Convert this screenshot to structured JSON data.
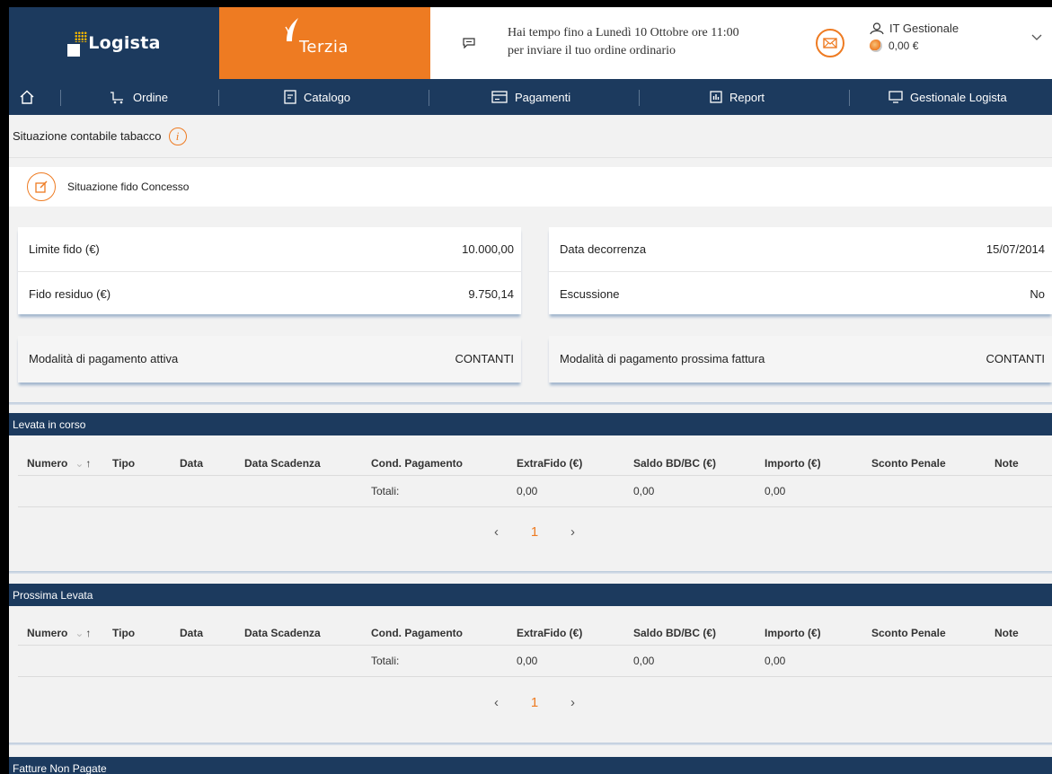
{
  "header": {
    "brand_logista": "Logista",
    "brand_terzia": "Terzia",
    "notice_line1": "Hai tempo fino a Lunedì 10 Ottobre ore 11:00",
    "notice_line2": "per inviare il tuo ordine ordinario",
    "user_name": "IT Gestionale",
    "user_balance": "0,00 €",
    "accent": "#ee7b22",
    "primary": "#1c3a5e"
  },
  "nav": {
    "home_icon": "home-icon",
    "items": [
      {
        "label": "Ordine",
        "icon": "cart-icon"
      },
      {
        "label": "Catalogo",
        "icon": "catalog-icon"
      },
      {
        "label": "Pagamenti",
        "icon": "card-icon"
      },
      {
        "label": "Report",
        "icon": "report-icon"
      },
      {
        "label": "Gestionale Logista",
        "icon": "monitor-icon"
      }
    ]
  },
  "page": {
    "title": "Situazione contabile tabacco",
    "subsection": "Situazione fido Concesso"
  },
  "fido": {
    "limite_label": "Limite fido (€)",
    "limite_value": "10.000,00",
    "residuo_label": "Fido residuo (€)",
    "residuo_value": "9.750,14",
    "decorrenza_label": "Data decorrenza",
    "decorrenza_value": "15/07/2014",
    "escussione_label": "Escussione",
    "escussione_value": "No",
    "mod_attiva_label": "Modalità di pagamento attiva",
    "mod_attiva_value": "CONTANTI",
    "mod_prossima_label": "Modalità di pagamento prossima fattura",
    "mod_prossima_value": "CONTANTI"
  },
  "columns": [
    "Numero",
    "Tipo",
    "Data",
    "Data Scadenza",
    "Cond. Pagamento",
    "ExtraFido (€)",
    "Saldo BD/BC (€)",
    "Importo (€)",
    "Sconto Penale",
    "Note"
  ],
  "levata_in_corso": {
    "title": "Levata in corso",
    "totali_label": "Totali:",
    "totali": [
      "0,00",
      "0,00",
      "0,00"
    ],
    "page": "1"
  },
  "prossima_levata": {
    "title": "Prossima Levata",
    "totali_label": "Totali:",
    "totali": [
      "0,00",
      "0,00",
      "0,00"
    ],
    "page": "1"
  },
  "fatture_non_pagate": {
    "title": "Fatture Non Pagate"
  }
}
